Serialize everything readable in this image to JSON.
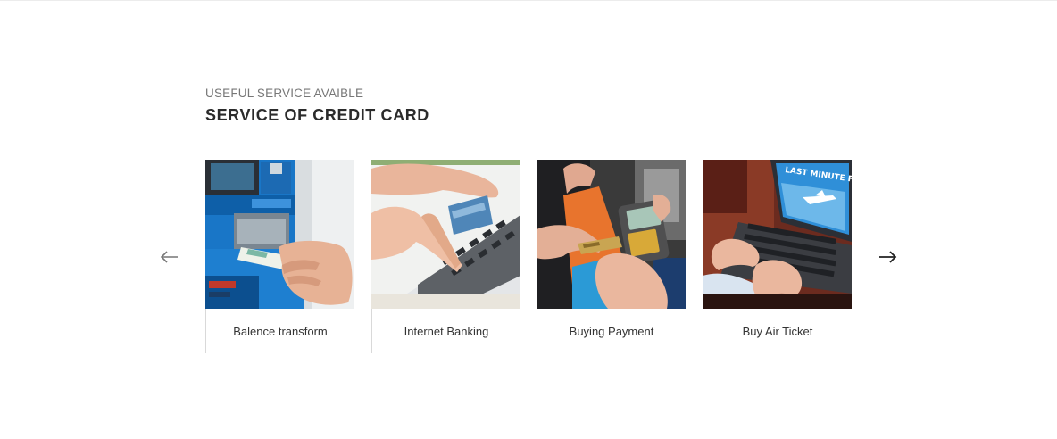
{
  "section": {
    "eyebrow": "USEFUL SERVICE AVAIBLE",
    "title": "SERVICE OF CREDIT CARD"
  },
  "carousel": {
    "prev_icon": "arrow-left-icon",
    "next_icon": "arrow-right-icon",
    "cards": [
      {
        "label": "Balence transform",
        "image": "atm-card-photo"
      },
      {
        "label": "Internet Banking",
        "image": "laptop-card-photo"
      },
      {
        "label": "Buying Payment",
        "image": "card-terminal-photo"
      },
      {
        "label": "Buy Air Ticket",
        "image": "flight-laptop-photo",
        "image_text": "LAST MINUTE FLIGHT"
      }
    ]
  },
  "colors": {
    "title": "#2b2b2b",
    "eyebrow": "#777777",
    "caption_border": "#d9d9d9"
  }
}
